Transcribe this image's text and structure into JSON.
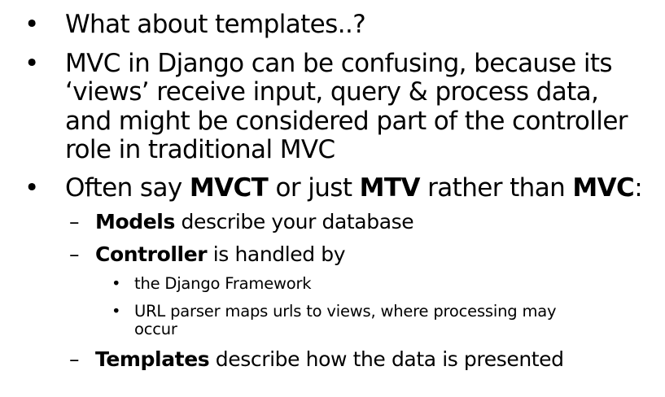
{
  "slide": {
    "bullets": [
      {
        "lines": [
          "What about templates..?"
        ]
      },
      {
        "lines": [
          "MVC in Django can be confusing, because its",
          "‘views’ receive input, query & process data,",
          "and might be considered part of the controller",
          "role in traditional MVC"
        ]
      },
      {
        "parts": [
          "Often say ",
          "MVCT",
          " or just ",
          "MTV",
          " rather than ",
          "MVC",
          ":"
        ],
        "sub": [
          {
            "bold": "Models",
            "text": " describe your database"
          },
          {
            "bold": "Controller",
            "text": " is handled by",
            "sub": [
              {
                "lines": [
                  "the Django Framework"
                ]
              },
              {
                "lines": [
                  "URL parser maps urls to views, where processing may",
                  "occur"
                ]
              }
            ]
          },
          {
            "bold": "Templates",
            "text": " describe how the data is presented"
          }
        ]
      }
    ],
    "bullet_char": "•",
    "dash_char": "–"
  }
}
